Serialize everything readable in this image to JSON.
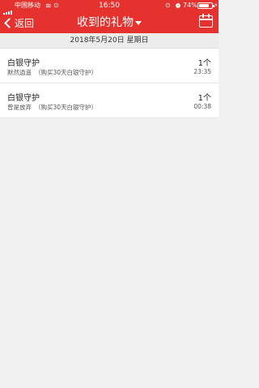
{
  "status_bar": {
    "carrier": "中国移动",
    "wifi_icon": "wifi-icon",
    "extra": "⊙",
    "time": "16:50",
    "lock_icon": "⊙",
    "alarm_icon": "⏰",
    "battery_pct": "74%",
    "charge_icon": "⚡"
  },
  "nav": {
    "back_label": "返回",
    "title": "收到的礼物",
    "calendar_icon": "calendar-icon"
  },
  "date_header": "2018年5月20日 星期日",
  "gifts": [
    {
      "name": "白银守护",
      "sender": "默然逍遥",
      "note": "（购买30天白银守护）",
      "quantity": "1个",
      "time": "23:35"
    },
    {
      "name": "白银守护",
      "sender": "曾是放弃",
      "note": "（购买30天白银守护）",
      "quantity": "1个",
      "time": "00:38"
    }
  ],
  "colors": {
    "header_bg": "#e5322f",
    "page_bg": "#f1f1f1"
  }
}
